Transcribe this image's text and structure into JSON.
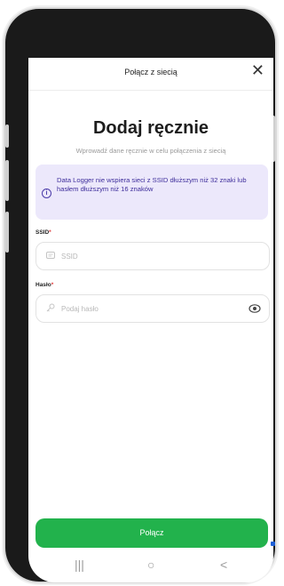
{
  "header": {
    "title": "Połącz z siecią",
    "close_icon": "✕"
  },
  "main": {
    "heading": "Dodaj ręcznie",
    "subtitle": "Wprowadź dane ręcznie w celu połączenia z siecią",
    "info": {
      "icon": "i",
      "text": "Data Logger nie wspiera sieci z SSID dłuższym niż 32 znaki lub hasłem dłuższym niż 16 znaków"
    },
    "ssid": {
      "label": "SSID",
      "required_mark": "*",
      "placeholder": "SSID",
      "value": ""
    },
    "password": {
      "label": "Hasło",
      "required_mark": "*",
      "placeholder": "Podaj hasło",
      "value": ""
    },
    "connect_label": "Połącz"
  },
  "navbar": {
    "recent": "|||",
    "home": "○",
    "back": "<"
  },
  "colors": {
    "accent": "#22b24c",
    "info_bg": "#ece8fb",
    "info_text": "#3f2f9c",
    "required": "#e03a3a"
  }
}
